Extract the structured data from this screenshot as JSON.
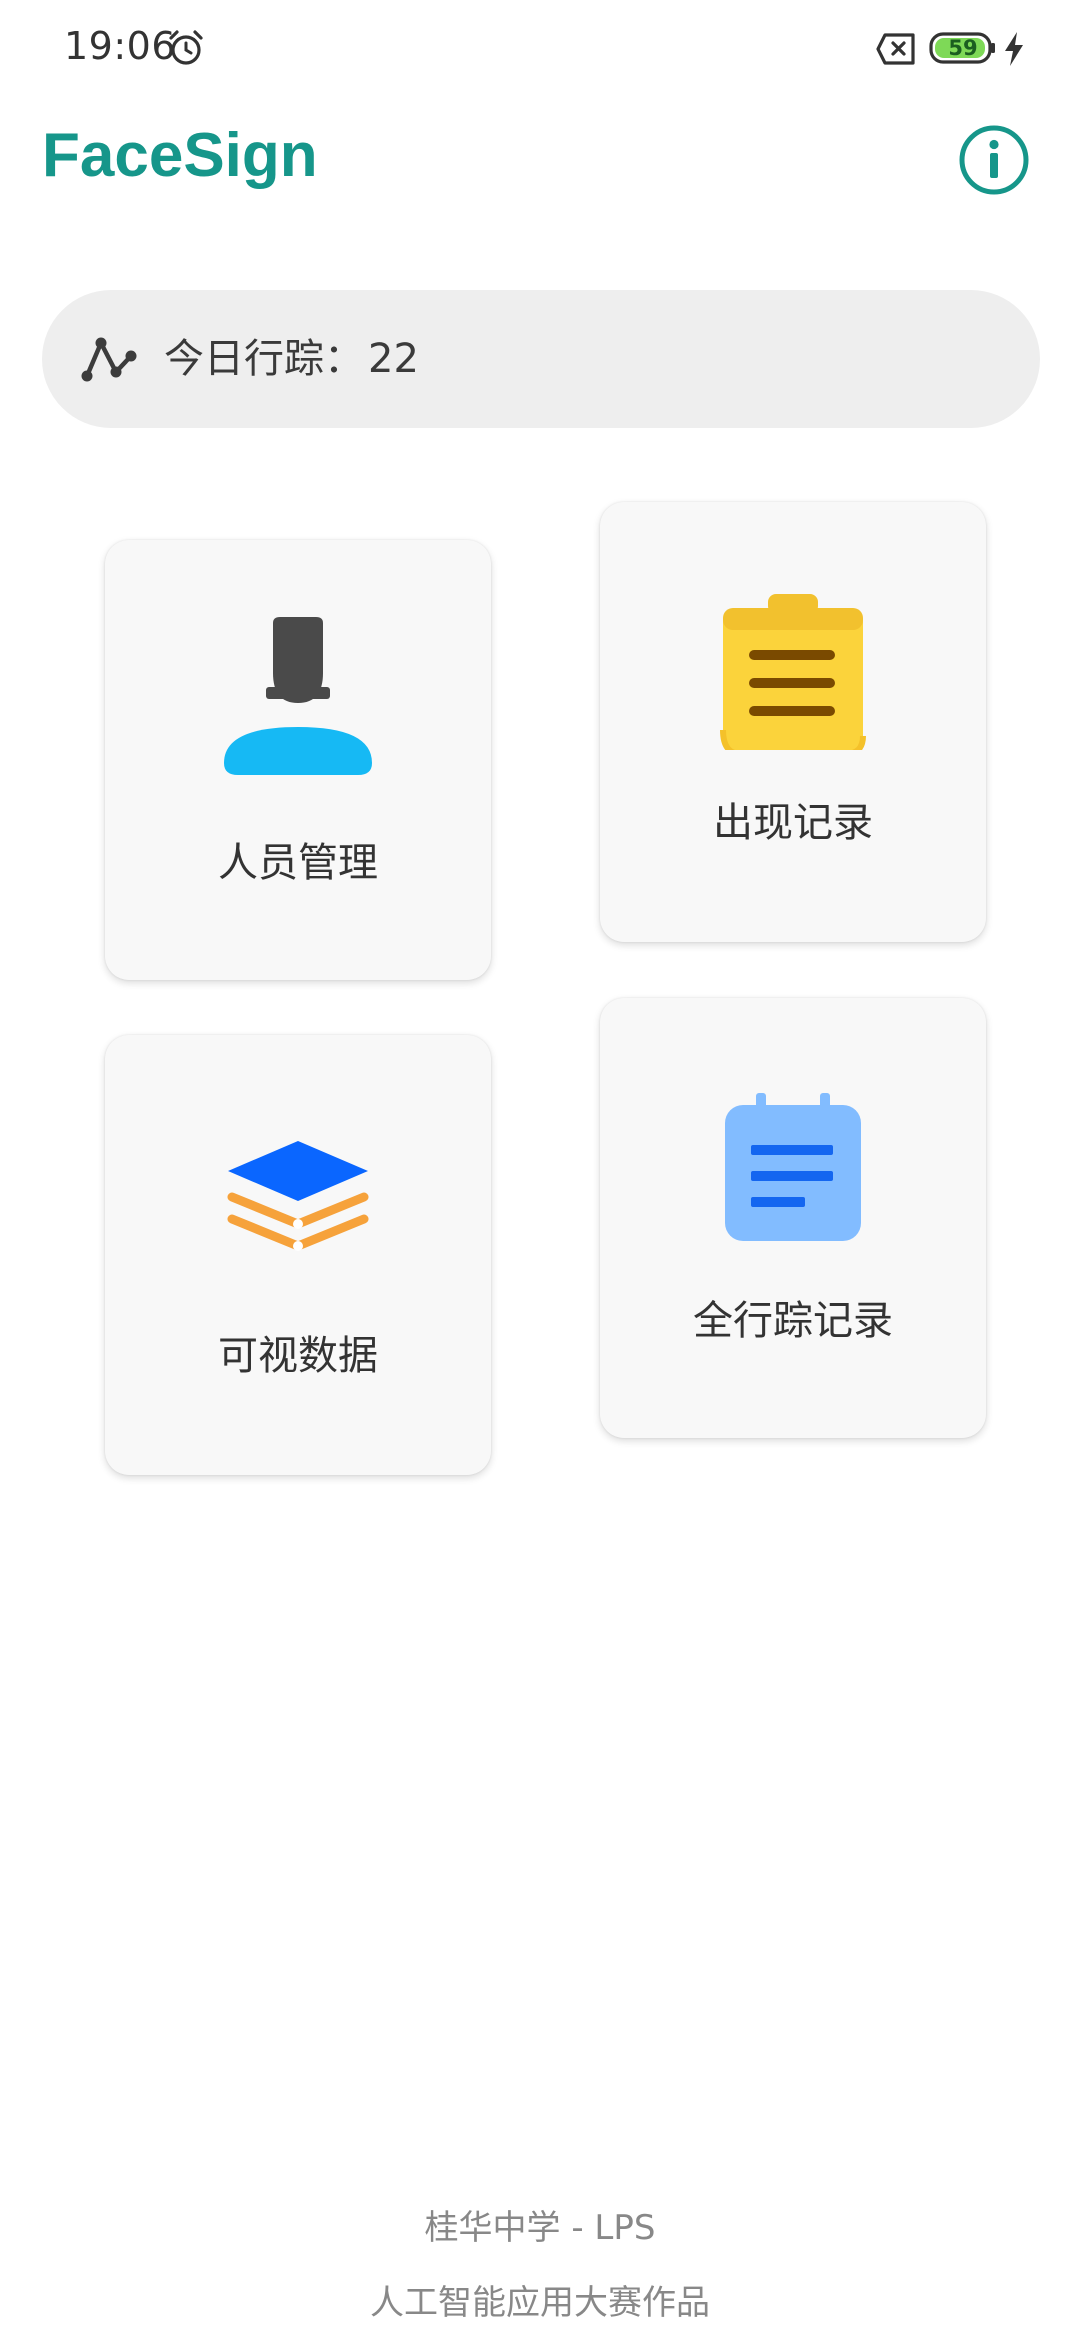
{
  "status_bar": {
    "time": "19:06",
    "battery_level": "59",
    "icons": [
      "alarm-clock-icon",
      "sim-no-signal-icon",
      "battery-icon",
      "charging-bolt-icon"
    ]
  },
  "header": {
    "title": "FaceSign",
    "info_icon": "info-icon"
  },
  "trace": {
    "label": "今日行踪：",
    "count": "22",
    "icon": "route-icon"
  },
  "cards": [
    {
      "label": "人员管理",
      "icon": "person-icon"
    },
    {
      "label": "出现记录",
      "icon": "clipboard-icon"
    },
    {
      "label": "可视数据",
      "icon": "layers-icon"
    },
    {
      "label": "全行踪记录",
      "icon": "notepad-icon"
    }
  ],
  "footer": {
    "line1": "桂华中学  - LPS",
    "line2": "人工智能应用大赛作品"
  },
  "colors": {
    "accent": "#16968a",
    "card_background": "#f8f8f8",
    "trace_bar_background": "#eeeeee"
  }
}
